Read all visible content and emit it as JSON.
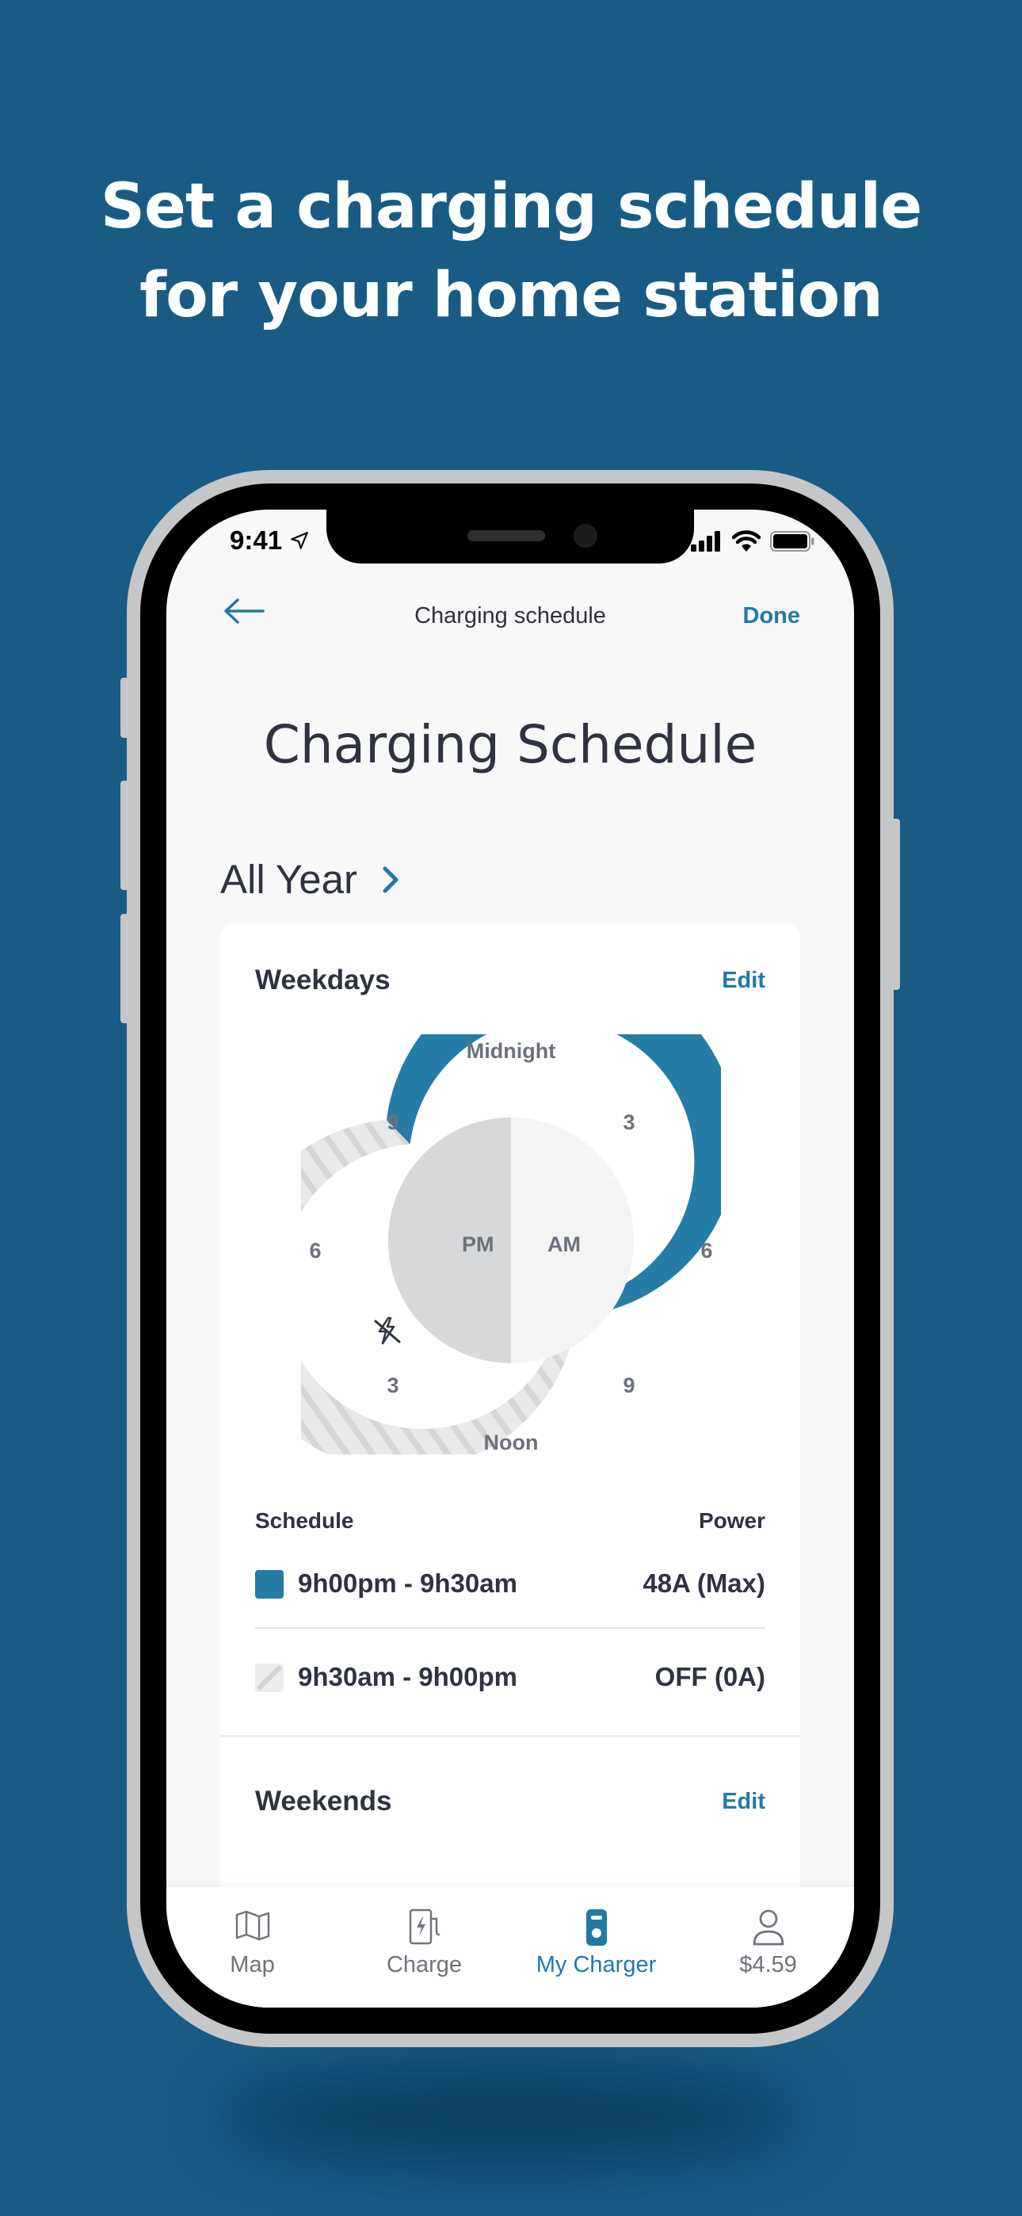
{
  "headline": {
    "line1": "Set a charging schedule",
    "line2": "for your home station"
  },
  "status_bar": {
    "time": "9:41",
    "icons": [
      "location-arrow-icon",
      "cellular-signal-icon",
      "wifi-icon",
      "battery-icon"
    ]
  },
  "nav": {
    "back_icon": "arrow-left-icon",
    "title": "Charging schedule",
    "done": "Done"
  },
  "page_title": "Charging Schedule",
  "season": {
    "label": "All Year",
    "icon": "chevron-right-icon"
  },
  "weekdays": {
    "title": "Weekdays",
    "edit": "Edit",
    "dial": {
      "top": "Midnight",
      "bottom": "Noon",
      "am": "AM",
      "pm": "PM",
      "tick_am_3": "3",
      "tick_am_6": "6",
      "tick_am_9": "9",
      "tick_pm_3": "3",
      "tick_pm_6": "6",
      "tick_pm_9": "9",
      "charging_icon": "lightning-icon",
      "off_icon": "no-charging-icon"
    },
    "schedule_header": "Schedule",
    "power_header": "Power",
    "rows": [
      {
        "time": "9h00pm - 9h30am",
        "power": "48A (Max)",
        "swatch": "#247ca7"
      },
      {
        "time": "9h30am - 9h00pm",
        "power": "OFF (0A)",
        "swatch": "#e4e4e4"
      }
    ]
  },
  "weekends": {
    "title": "Weekends",
    "edit": "Edit"
  },
  "tabs": [
    {
      "label": "Map",
      "icon": "map-icon"
    },
    {
      "label": "Charge",
      "icon": "charger-icon"
    },
    {
      "label": "My Charger",
      "icon": "home-charger-icon",
      "active": true
    },
    {
      "label": "$4.59",
      "icon": "user-icon"
    }
  ],
  "colors": {
    "background": "#185c86",
    "accent": "#247ca7",
    "link": "#1f7aa8",
    "text": "#2f3340"
  }
}
